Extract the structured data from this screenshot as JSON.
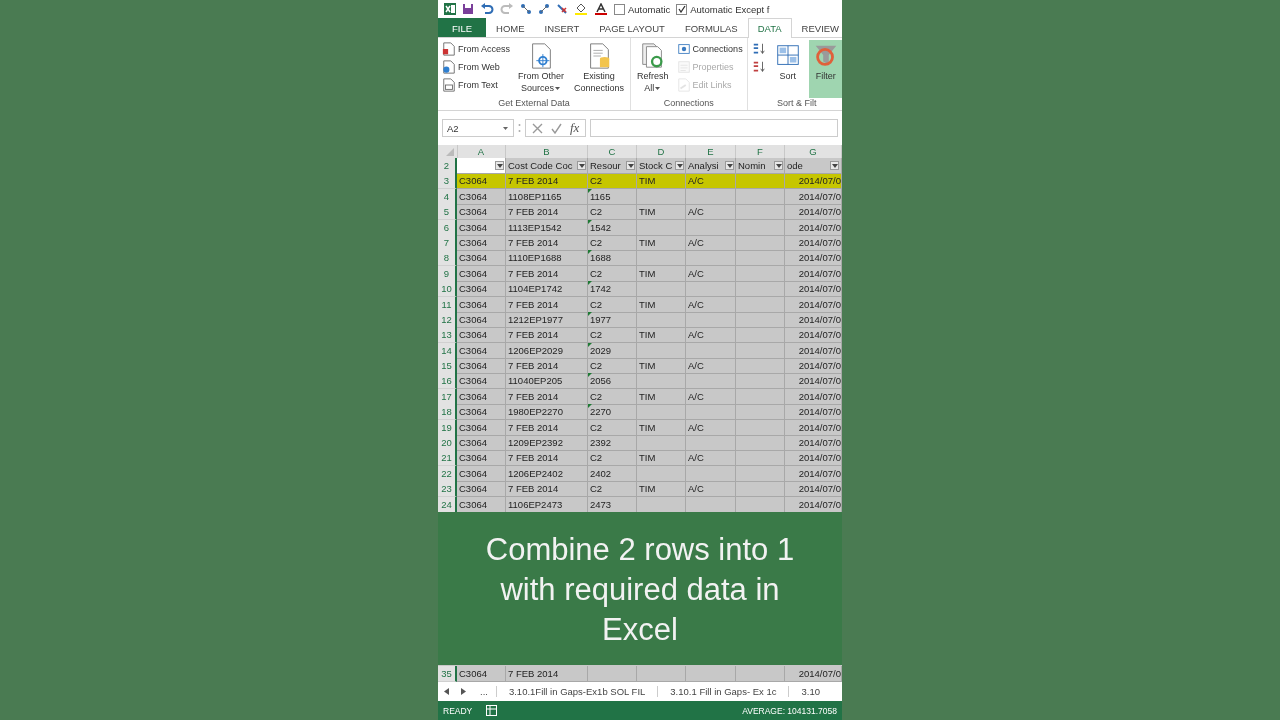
{
  "quick_access": {
    "checkboxes": [
      {
        "label": "Automatic",
        "checked": false
      },
      {
        "label": "Automatic Except f",
        "checked": true
      }
    ]
  },
  "tabs": [
    {
      "label": "FILE",
      "kind": "file",
      "selected": false
    },
    {
      "label": "HOME",
      "kind": "tab",
      "selected": false
    },
    {
      "label": "INSERT",
      "kind": "tab",
      "selected": false
    },
    {
      "label": "PAGE LAYOUT",
      "kind": "tab",
      "selected": false
    },
    {
      "label": "FORMULAS",
      "kind": "tab",
      "selected": false
    },
    {
      "label": "DATA",
      "kind": "tab",
      "selected": true
    },
    {
      "label": "REVIEW",
      "kind": "tab",
      "selected": false
    }
  ],
  "ribbon": {
    "groups": [
      {
        "label": "Get External Data",
        "items": [
          {
            "kind": "stack",
            "buttons": [
              {
                "label": "From Access",
                "disabled": false
              },
              {
                "label": "From Web",
                "disabled": false
              },
              {
                "label": "From Text",
                "disabled": false
              }
            ]
          },
          {
            "kind": "large",
            "lines": [
              "From Other",
              "Sources"
            ],
            "dropdown": true,
            "on": false
          },
          {
            "kind": "large",
            "lines": [
              "Existing",
              "Connections"
            ],
            "dropdown": false,
            "on": false
          }
        ]
      },
      {
        "label": "Connections",
        "items": [
          {
            "kind": "large",
            "lines": [
              "Refresh",
              "All"
            ],
            "dropdown": true,
            "on": false
          },
          {
            "kind": "stack",
            "buttons": [
              {
                "label": "Connections",
                "disabled": false
              },
              {
                "label": "Properties",
                "disabled": true
              },
              {
                "label": "Edit Links",
                "disabled": true
              }
            ]
          }
        ]
      },
      {
        "label": "Sort & Filt",
        "items": [
          {
            "kind": "stack",
            "buttons": [
              {
                "disabled": false
              },
              {
                "disabled": false
              }
            ]
          },
          {
            "kind": "large",
            "lines": [
              "Sort"
            ],
            "dropdown": false,
            "on": false
          },
          {
            "kind": "large",
            "lines": [
              "Filter"
            ],
            "dropdown": false,
            "on": true
          }
        ]
      }
    ]
  },
  "formula_bar": {
    "name_box": "A2",
    "function_label": "fx"
  },
  "columns": [
    "A",
    "B",
    "C",
    "D",
    "E",
    "F",
    "G"
  ],
  "header_row": {
    "number": "2",
    "cells": [
      null,
      "Cost Code Coc",
      "Resour",
      "Stock C",
      "Analysi",
      "Nomin",
      "ode"
    ]
  },
  "rows": [
    {
      "number": "3",
      "selected": true,
      "error_mark": false,
      "cells": [
        "C3064",
        "7 FEB 2014",
        "C2",
        "TIM",
        "A/C",
        null,
        "2014/07/0"
      ]
    },
    {
      "number": "4",
      "selected": false,
      "error_mark": true,
      "cells": [
        "C3064",
        "1108EP1165",
        "1165",
        null,
        null,
        null,
        "2014/07/0"
      ]
    },
    {
      "number": "5",
      "selected": false,
      "error_mark": false,
      "cells": [
        "C3064",
        "7 FEB 2014",
        "C2",
        "TIM",
        "A/C",
        null,
        "2014/07/0"
      ]
    },
    {
      "number": "6",
      "selected": false,
      "error_mark": true,
      "cells": [
        "C3064",
        "1113EP1542",
        "1542",
        null,
        null,
        null,
        "2014/07/0"
      ]
    },
    {
      "number": "7",
      "selected": false,
      "error_mark": false,
      "cells": [
        "C3064",
        "7 FEB 2014",
        "C2",
        "TIM",
        "A/C",
        null,
        "2014/07/0"
      ]
    },
    {
      "number": "8",
      "selected": false,
      "error_mark": true,
      "cells": [
        "C3064",
        "1110EP1688",
        "1688",
        null,
        null,
        null,
        "2014/07/0"
      ]
    },
    {
      "number": "9",
      "selected": false,
      "error_mark": false,
      "cells": [
        "C3064",
        "7 FEB 2014",
        "C2",
        "TIM",
        "A/C",
        null,
        "2014/07/0"
      ]
    },
    {
      "number": "10",
      "selected": false,
      "error_mark": true,
      "cells": [
        "C3064",
        "1104EP1742",
        "1742",
        null,
        null,
        null,
        "2014/07/0"
      ]
    },
    {
      "number": "11",
      "selected": false,
      "error_mark": false,
      "cells": [
        "C3064",
        "7 FEB 2014",
        "C2",
        "TIM",
        "A/C",
        null,
        "2014/07/0"
      ]
    },
    {
      "number": "12",
      "selected": false,
      "error_mark": true,
      "cells": [
        "C3064",
        "1212EP1977",
        "1977",
        null,
        null,
        null,
        "2014/07/0"
      ]
    },
    {
      "number": "13",
      "selected": false,
      "error_mark": false,
      "cells": [
        "C3064",
        "7 FEB 2014",
        "C2",
        "TIM",
        "A/C",
        null,
        "2014/07/0"
      ]
    },
    {
      "number": "14",
      "selected": false,
      "error_mark": true,
      "cells": [
        "C3064",
        "1206EP2029",
        "2029",
        null,
        null,
        null,
        "2014/07/0"
      ]
    },
    {
      "number": "15",
      "selected": false,
      "error_mark": false,
      "cells": [
        "C3064",
        "7 FEB 2014",
        "C2",
        "TIM",
        "A/C",
        null,
        "2014/07/0"
      ]
    },
    {
      "number": "16",
      "selected": false,
      "error_mark": true,
      "cells": [
        "C3064",
        "11040EP205",
        "2056",
        null,
        null,
        null,
        "2014/07/0"
      ]
    },
    {
      "number": "17",
      "selected": false,
      "error_mark": false,
      "cells": [
        "C3064",
        "7 FEB 2014",
        "C2",
        "TIM",
        "A/C",
        null,
        "2014/07/0"
      ]
    },
    {
      "number": "18",
      "selected": false,
      "error_mark": true,
      "cells": [
        "C3064",
        "1980EP2270",
        "2270",
        null,
        null,
        null,
        "2014/07/0"
      ]
    },
    {
      "number": "19",
      "selected": false,
      "error_mark": false,
      "cells": [
        "C3064",
        "7 FEB 2014",
        "C2",
        "TIM",
        "A/C",
        null,
        "2014/07/0"
      ]
    },
    {
      "number": "20",
      "selected": false,
      "error_mark": false,
      "cells": [
        "C3064",
        "1209EP2392",
        "2392",
        null,
        null,
        null,
        "2014/07/0"
      ]
    },
    {
      "number": "21",
      "selected": false,
      "error_mark": false,
      "cells": [
        "C3064",
        "7 FEB 2014",
        "C2",
        "TIM",
        "A/C",
        null,
        "2014/07/0"
      ]
    },
    {
      "number": "22",
      "selected": false,
      "error_mark": false,
      "cells": [
        "C3064",
        "1206EP2402",
        "2402",
        null,
        null,
        null,
        "2014/07/0"
      ]
    },
    {
      "number": "23",
      "selected": false,
      "error_mark": false,
      "cells": [
        "C3064",
        "7 FEB 2014",
        "C2",
        "TIM",
        "A/C",
        null,
        "2014/07/0"
      ]
    },
    {
      "number": "24",
      "selected": false,
      "error_mark": false,
      "cells": [
        "C3064",
        "1106EP2473",
        "2473",
        null,
        null,
        null,
        "2014/07/0"
      ]
    }
  ],
  "caption": "Combine 2 rows into 1 with required data in Excel",
  "bottom_row": {
    "number": "35",
    "selected": false,
    "error_mark": false,
    "cells": [
      "C3064",
      "7 FEB 2014",
      null,
      null,
      null,
      null,
      "2014/07/0"
    ]
  },
  "sheet_tabs": {
    "more": "...",
    "tabs": [
      {
        "label": "3.10.1Fill in Gaps-Ex1b SOL FIL",
        "selected": false
      },
      {
        "label": "3.10.1 Fill in Gaps- Ex 1c",
        "selected": false
      },
      {
        "label": "3.10",
        "selected": false
      }
    ]
  },
  "status_bar": {
    "mode": "READY",
    "summary": "AVERAGE: 104131.7058"
  }
}
